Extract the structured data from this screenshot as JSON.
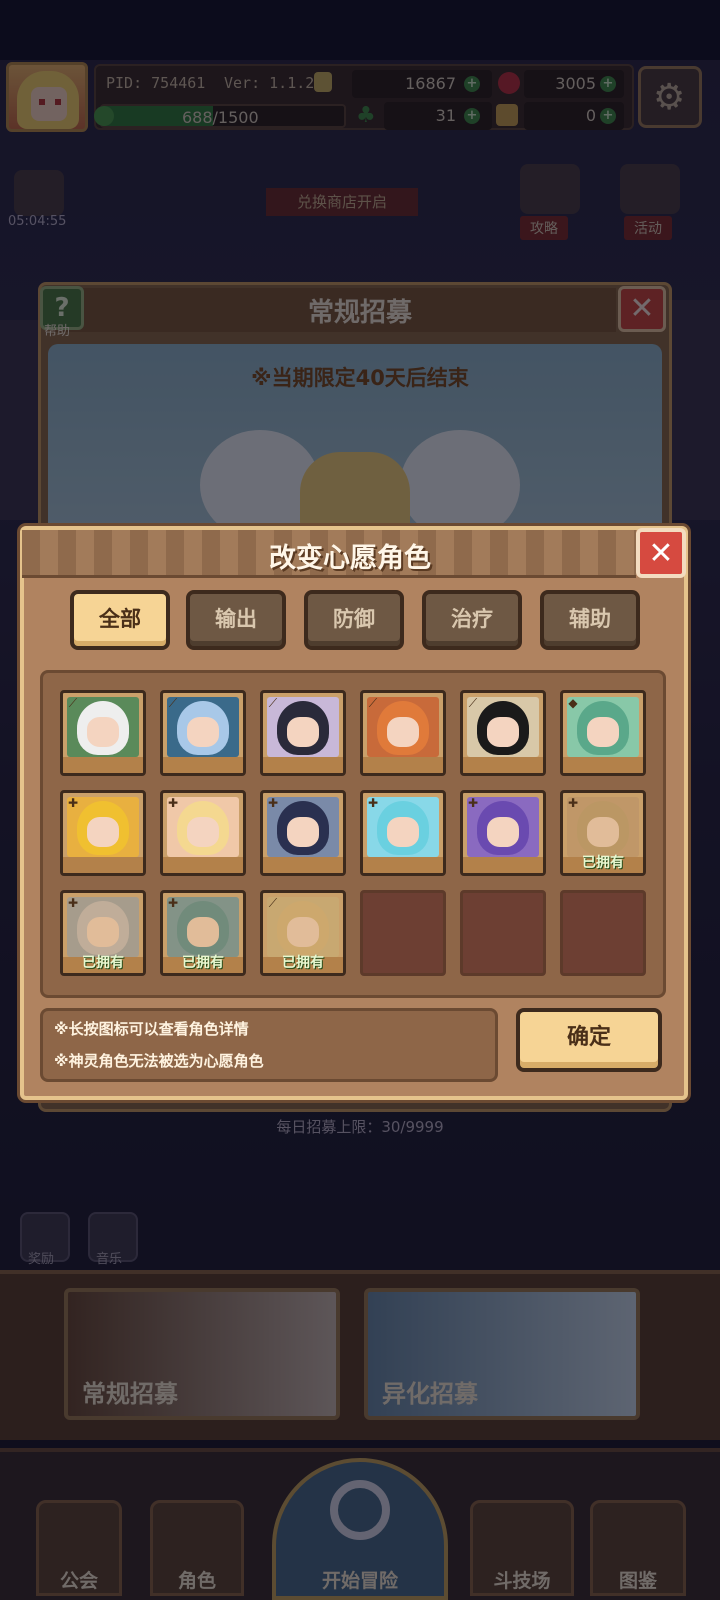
{
  "header": {
    "pid": "PID: 754461",
    "version": "Ver: 1.1.2.0",
    "exp_text": "688/1500",
    "exp_fraction": 0.459,
    "gold": "16867",
    "gems": "3005",
    "clover": "31",
    "keys": "0"
  },
  "background": {
    "timer": "05:04:55",
    "shop_banner": "兑换商店开启",
    "guide_label": "攻略",
    "event_label": "活动",
    "recruit_title": "常规招募",
    "help_label": "帮助",
    "limited_notice": "※当期限定40天后结束",
    "daily_limit": "每日招募上限：30/9999",
    "mini_label_1": "奖励",
    "mini_label_2": "音乐",
    "banner_normal": "常规招募",
    "banner_alien": "异化招募"
  },
  "bottom_nav": {
    "guild": "公会",
    "character": "角色",
    "adventure": "开始冒险",
    "arena": "斗技场",
    "codex": "图鉴"
  },
  "dialog": {
    "title": "改变心愿角色",
    "tabs": [
      "全部",
      "输出",
      "防御",
      "治疗",
      "辅助"
    ],
    "owned_label": "已拥有",
    "notes": [
      "※长按图标可以查看角色详情",
      "※神灵角色无法被选为心愿角色"
    ],
    "confirm": "确定"
  },
  "characters": [
    {
      "hair": "#eeeeee",
      "bg": "#5a8a5a",
      "owned": false,
      "corner": "spear"
    },
    {
      "hair": "#a8c8e8",
      "bg": "#3a6a8a",
      "owned": false,
      "corner": "spear"
    },
    {
      "hair": "#2a2a3a",
      "bg": "#c8b8d8",
      "owned": false,
      "corner": "spear"
    },
    {
      "hair": "#e07a3a",
      "bg": "#c86a3a",
      "owned": false,
      "corner": "spear"
    },
    {
      "hair": "#1a1a1a",
      "bg": "#d8c8a8",
      "owned": false,
      "corner": "spear"
    },
    {
      "hair": "#5aa88a",
      "bg": "#88c8a8",
      "owned": false,
      "corner": "shield"
    },
    {
      "hair": "#f0c030",
      "bg": "#e8b040",
      "owned": false,
      "corner": "plus"
    },
    {
      "hair": "#f4d890",
      "bg": "#f0c8a8",
      "owned": false,
      "corner": "plus"
    },
    {
      "hair": "#2a3050",
      "bg": "#7a8aa8",
      "owned": false,
      "corner": "plus"
    },
    {
      "hair": "#6ad0e0",
      "bg": "#88d8e8",
      "owned": false,
      "corner": "plus"
    },
    {
      "hair": "#6a4ab0",
      "bg": "#8a6ac0",
      "owned": false,
      "corner": "plus"
    },
    {
      "hair": "#b09060",
      "bg": "#b89068",
      "owned": true,
      "corner": "plus"
    },
    {
      "hair": "#b8b8c0",
      "bg": "#8a9aa8",
      "owned": true,
      "corner": "plus"
    },
    {
      "hair": "#2a7a8a",
      "bg": "#4a8aa0",
      "owned": true,
      "corner": "plus"
    },
    {
      "hair": "#d0b070",
      "bg": "#c8b078",
      "owned": true,
      "corner": "spear"
    }
  ]
}
